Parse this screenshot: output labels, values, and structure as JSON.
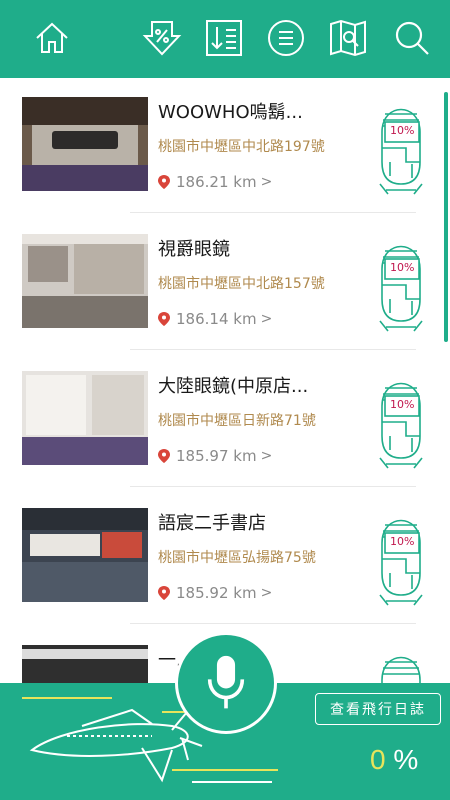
{
  "app": {
    "accent": "#1fad8a",
    "address_color": "#b08a4e",
    "discount_color": "#c0174d"
  },
  "topbar": {
    "icons": [
      "home-icon",
      "discount-sort-icon",
      "distance-sort-icon",
      "menu-icon",
      "map-search-icon",
      "search-icon"
    ]
  },
  "stores": [
    {
      "name": "WOOWHO嗚鬍...",
      "address": "桃園市中壢區中北路197號",
      "distance": "186.21 km",
      "discount": "10%"
    },
    {
      "name": "視爵眼鏡",
      "address": "桃園市中壢區中北路157號",
      "distance": "186.14 km",
      "discount": "10%"
    },
    {
      "name": "大陸眼鏡(中原店...",
      "address": "桃園市中壢區日新路71號",
      "distance": "185.97 km",
      "discount": "10%"
    },
    {
      "name": "語宸二手書店",
      "address": "桃園市中壢區弘揚路75號",
      "distance": "185.92 km",
      "discount": "10%"
    },
    {
      "name": "一...",
      "address": "",
      "distance": "",
      "discount": ""
    }
  ],
  "bottom": {
    "log_button": "查看飛行日誌",
    "progress_value": "0",
    "progress_unit": "%"
  }
}
